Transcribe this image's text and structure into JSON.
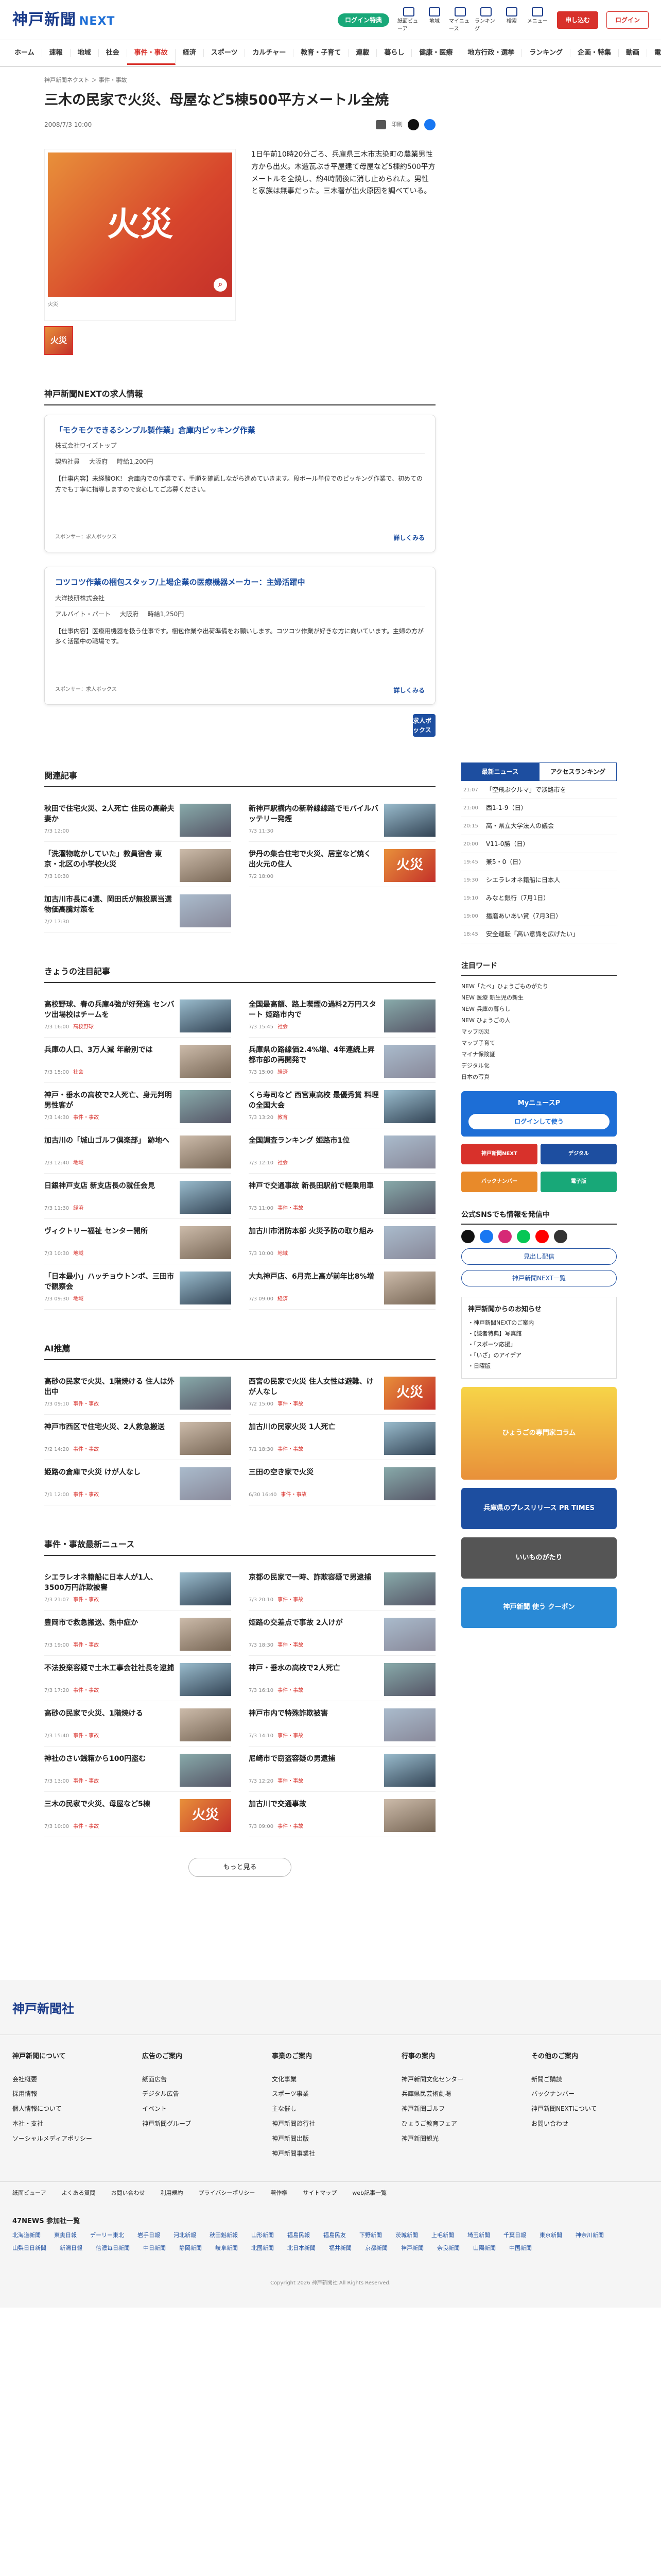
{
  "header": {
    "logo": "神戸新聞",
    "logo_sub": "NEXT",
    "cta": "ログイン特典",
    "icons": [
      "紙面ビューア",
      "地域",
      "マイニュース",
      "ランキング",
      "検索",
      "メニュー"
    ],
    "subscribe": "申し込む",
    "login": "ログイン"
  },
  "nav": [
    "ホーム",
    "速報",
    "地域",
    "社会",
    "事件・事故",
    "経済",
    "スポーツ",
    "カルチャー",
    "教育・子育て",
    "連載",
    "暮らし",
    "健康・医療",
    "地方行政・選挙",
    "ランキング",
    "企画・特集",
    "動画",
    "電子版"
  ],
  "nav_active_index": 4,
  "breadcrumb": "神戸新聞ネクスト ＞ 事件・事故",
  "article": {
    "title": "三木の民家で火災、母屋など5棟500平方メートル全焼",
    "date": "2008/7/3 10:00",
    "share_label": "印刷",
    "photo_text": "火災",
    "photo_caption": "火災",
    "thumb_text": "火災",
    "body": "1日午前10時20分ごろ、兵庫県三木市志染町の農業男性方から出火。木造瓦ぶき平屋建て母屋など5棟約500平方メートルを全焼し、約4時間後に消し止められた。男性と家族は無事だった。三木署が出火原因を調べている。"
  },
  "jobs": {
    "heading": "神戸新聞NEXTの求人情報",
    "items": [
      {
        "title": "「モクモクできるシンプル製作業」倉庫内ピッキング作業",
        "company": "株式会社ワイズトップ",
        "type": "契約社員",
        "place": "大阪府",
        "pay": "時給1,200円",
        "desc": "【仕事内容】未経験OK！ 倉庫内での作業です。手順を確認しながら進めていきます。段ボール単位でのピッキング作業で、初めての方でも丁寧に指導しますので安心してご応募ください。",
        "source": "スポンサー：求人ボックス",
        "more": "詳しくみる"
      },
      {
        "title": "コツコツ作業の梱包スタッフ/上場企業の医療機器メーカー：主婦活躍中",
        "company": "大洋技研株式会社",
        "type": "アルバイト・パート",
        "place": "大阪府",
        "pay": "時給1,250円",
        "desc": "【仕事内容】医療用機器を扱う仕事です。梱包作業や出荷準備をお願いします。コツコツ作業が好きな方に向いています。主婦の方が多く活躍中の職場です。",
        "source": "スポンサー：求人ボックス",
        "more": "詳しくみる"
      }
    ],
    "badge": "求人ボックス"
  },
  "related": {
    "heading": "関連記事",
    "items": [
      {
        "title": "秋田で住宅火災、2人死亡 住民の高齢夫妻か",
        "meta": "7/3 12:00",
        "tag": "",
        "th": "t1"
      },
      {
        "title": "新神戸駅構内の新幹線線路でモバイルバッテリー発煙",
        "meta": "7/3 11:30",
        "tag": "",
        "th": "t2"
      },
      {
        "title": "「洗濯物乾かしていた」教員宿舎 東京・北区の小学校火災",
        "meta": "7/3 10:30",
        "tag": "",
        "th": "t3"
      },
      {
        "title": "伊丹の集合住宅で火災、居室など焼く 出火元の住人",
        "meta": "7/2 18:00",
        "tag": "",
        "th": "tf"
      },
      {
        "title": "加古川市長に4選、岡田氏が無投票当選 物価高騰対策を",
        "meta": "7/2 17:30",
        "tag": "",
        "th": "t4"
      }
    ]
  },
  "featured": {
    "heading": "きょうの注目記事",
    "items": [
      {
        "title": "高校野球、春の兵庫4強が好発進 センバツ出場校はチームを",
        "meta": "7/3 16:00",
        "tag": "高校野球",
        "th": "t2"
      },
      {
        "title": "全国最高額、路上喫煙の過料2万円スタート 姫路市内で",
        "meta": "7/3 15:45",
        "tag": "社会",
        "th": "t1"
      },
      {
        "title": "兵庫の人口、3万人減 年齢別では",
        "meta": "7/3 15:00",
        "tag": "社会",
        "th": "t3"
      },
      {
        "title": "兵庫県の路線価2.4%増、4年連続上昇 都市部の再開発で",
        "meta": "7/3 15:00",
        "tag": "経済",
        "th": "t4"
      },
      {
        "title": "神戸・垂水の高校で2人死亡、身元判明 男性客が",
        "meta": "7/3 14:30",
        "tag": "事件・事故",
        "th": "t1"
      },
      {
        "title": "くら寿司など 西宮東高校 最優秀賞 料理の全国大会",
        "meta": "7/3 13:20",
        "tag": "教育",
        "th": "t2"
      },
      {
        "title": "加古川の「城山ゴルフ倶楽部」 跡地へ",
        "meta": "7/3 12:40",
        "tag": "地域",
        "th": "t3"
      },
      {
        "title": "全国調査ランキング 姫路市1位",
        "meta": "7/3 12:10",
        "tag": "社会",
        "th": "t4"
      },
      {
        "title": "日銀神戸支店 新支店長の就任会見",
        "meta": "7/3 11:30",
        "tag": "経済",
        "th": "t2"
      },
      {
        "title": "神戸で交通事故 新長田駅前で軽乗用車",
        "meta": "7/3 11:00",
        "tag": "事件・事故",
        "th": "t1"
      },
      {
        "title": "ヴィクトリー福祉 センター開所",
        "meta": "7/3 10:30",
        "tag": "地域",
        "th": "t3"
      },
      {
        "title": "加古川市消防本部 火災予防の取り組み",
        "meta": "7/3 10:00",
        "tag": "地域",
        "th": "t4"
      },
      {
        "title": "「日本最小」ハッチョウトンボ、三田市で観察会",
        "meta": "7/3 09:30",
        "tag": "地域",
        "th": "t2"
      },
      {
        "title": "大丸神戸店、6月売上高が前年比8%増",
        "meta": "7/3 09:00",
        "tag": "経済",
        "th": "t3"
      }
    ]
  },
  "ai": {
    "heading": "AI推薦",
    "items": [
      {
        "title": "高砂の民家で火災、1階焼ける 住人は外出中",
        "meta": "7/3 09:10",
        "tag": "事件・事故",
        "th": "t1"
      },
      {
        "title": "西宮の民家で火災 住人女性は避難、けが人なし",
        "meta": "7/2 15:00",
        "tag": "事件・事故",
        "th": "tf"
      },
      {
        "title": "神戸市西区で住宅火災、2人救急搬送",
        "meta": "7/2 14:20",
        "tag": "事件・事故",
        "th": "t3"
      },
      {
        "title": "加古川の民家火災 1人死亡",
        "meta": "7/1 18:30",
        "tag": "事件・事故",
        "th": "t2"
      },
      {
        "title": "姫路の倉庫で火災 けが人なし",
        "meta": "7/1 12:00",
        "tag": "事件・事故",
        "th": "t4"
      },
      {
        "title": "三田の空き家で火災",
        "meta": "6/30 16:40",
        "tag": "事件・事故",
        "th": "t1"
      }
    ]
  },
  "incident": {
    "heading": "事件・事故最新ニュース",
    "items": [
      {
        "title": "シエラレオネ籍船に日本人が1人、3500万円詐欺被害",
        "meta": "7/3 21:07",
        "tag": "事件・事故",
        "th": "t2"
      },
      {
        "title": "京都の民家で一時、詐欺容疑で男逮捕",
        "meta": "7/3 20:10",
        "tag": "事件・事故",
        "th": "t1"
      },
      {
        "title": "豊岡市で救急搬送、熱中症か",
        "meta": "7/3 19:00",
        "tag": "事件・事故",
        "th": "t3"
      },
      {
        "title": "姫路の交差点で事故 2人けが",
        "meta": "7/3 18:30",
        "tag": "事件・事故",
        "th": "t4"
      },
      {
        "title": "不法投棄容疑で土木工事会社社長を逮捕",
        "meta": "7/3 17:20",
        "tag": "事件・事故",
        "th": "t2"
      },
      {
        "title": "神戸・垂水の高校で2人死亡",
        "meta": "7/3 16:10",
        "tag": "事件・事故",
        "th": "t1"
      },
      {
        "title": "高砂の民家で火災、1階焼ける",
        "meta": "7/3 15:40",
        "tag": "事件・事故",
        "th": "t3"
      },
      {
        "title": "神戸市内で特殊詐欺被害",
        "meta": "7/3 14:10",
        "tag": "事件・事故",
        "th": "t4"
      },
      {
        "title": "神社のさい銭箱から100円盗む",
        "meta": "7/3 13:00",
        "tag": "事件・事故",
        "th": "t1"
      },
      {
        "title": "尼崎市で窃盗容疑の男逮捕",
        "meta": "7/3 12:20",
        "tag": "事件・事故",
        "th": "t2"
      },
      {
        "title": "三木の民家で火災、母屋など5棟",
        "meta": "7/3 10:00",
        "tag": "事件・事故",
        "th": "tf"
      },
      {
        "title": "加古川で交通事故",
        "meta": "7/3 09:00",
        "tag": "事件・事故",
        "th": "t3"
      }
    ],
    "more": "もっと見る"
  },
  "sidebar": {
    "rank_tabs": [
      "最新ニュース",
      "アクセスランキング"
    ],
    "ranking": [
      {
        "time": "21:07",
        "text": "「空飛ぶクルマ」で淡路市を"
      },
      {
        "time": "21:00",
        "text": "西1-1-9（日）"
      },
      {
        "time": "20:15",
        "text": "高・県立大学法人の議会"
      },
      {
        "time": "20:00",
        "text": "V11-0勝（日）"
      },
      {
        "time": "19:45",
        "text": "兼5・0（日）"
      },
      {
        "time": "19:30",
        "text": "シエラレオネ籍船に日本人"
      },
      {
        "time": "19:10",
        "text": "みなと銀行（7月1日）"
      },
      {
        "time": "19:00",
        "text": "播磨あいあい賞（7月3日）"
      },
      {
        "time": "18:45",
        "text": "安全運転「高い意識を広げたい」"
      }
    ],
    "watch_heading": "注目ワード",
    "watch": [
      "NEW「たべ」ひょうごものがたり",
      "NEW 医療 新生児の新生",
      "NEW 兵庫の暮らし",
      "NEW ひょうごの人",
      "マップ防災",
      "マップ子育て",
      "マイナ保険証",
      "デジタル化",
      "日本の写真"
    ],
    "mynews_title": "MyニュースP",
    "mynews_btn": "ログインして使う",
    "banners": [
      "神戸新聞NEXT",
      "デジタル",
      "バックナンバー",
      "電子版"
    ],
    "sns_heading": "公式SNSでも情報を発信中",
    "sns_btn1": "見出し配信",
    "sns_btn2": "神戸新聞NEXT一覧",
    "notice_title": "神戸新聞からのお知らせ",
    "notices": [
      "・神戸新聞NEXTのご案内",
      "・【読者特典】写真館",
      "・「スポーツ応援」",
      "・「いざ」のアイデア",
      "・日曜版"
    ],
    "ad1": "ひょうごの専門家コラム",
    "ad2": "兵庫県のプレスリリース PR TIMES",
    "ad3": "いいものがたり",
    "ad4": "神戸新聞 使う クーポン"
  },
  "footer": {
    "logo": "神戸新聞社",
    "cols": [
      {
        "h": "神戸新聞について",
        "items": [
          "会社概要",
          "採用情報",
          "個人情報について",
          "本社・支社",
          "ソーシャルメディアポリシー"
        ]
      },
      {
        "h": "広告のご案内",
        "items": [
          "紙面広告",
          "デジタル広告",
          "イベント",
          "神戸新聞グループ"
        ]
      },
      {
        "h": "事業のご案内",
        "items": [
          "文化事業",
          "スポーツ事業",
          "主な催し",
          "神戸新聞旅行社",
          "神戸新聞出版",
          "神戸新聞事業社"
        ]
      },
      {
        "h": "行事の案内",
        "items": [
          "神戸新聞文化センター",
          "兵庫県民芸術劇場",
          "神戸新聞ゴルフ",
          "ひょうご教育フェア",
          "神戸新聞観光"
        ]
      },
      {
        "h": "その他のご案内",
        "items": [
          "新聞ご購読",
          "バックナンバー",
          "神戸新聞NEXTについて",
          "お問い合わせ"
        ]
      }
    ],
    "bar": [
      "紙面ビューア",
      "よくある質問",
      "お問い合わせ",
      "利用規約",
      "プライバシーポリシー",
      "著作権",
      "サイトマップ",
      "web記事一覧"
    ],
    "n47_heading": "47NEWS 参加社一覧",
    "n47": [
      "北海道新聞",
      "東奥日報",
      "デーリー東北",
      "岩手日報",
      "河北新報",
      "秋田魁新報",
      "山形新聞",
      "福島民報",
      "福島民友",
      "下野新聞",
      "茨城新聞",
      "上毛新聞",
      "埼玉新聞",
      "千葉日報",
      "東京新聞",
      "神奈川新聞",
      "山梨日日新聞",
      "新潟日報",
      "信濃毎日新聞",
      "中日新聞",
      "静岡新聞",
      "岐阜新聞",
      "北國新聞",
      "北日本新聞",
      "福井新聞",
      "京都新聞",
      "神戸新聞",
      "奈良新聞",
      "山陽新聞",
      "中国新聞"
    ],
    "copy": "Copyright 2026 神戸新聞社 All Rights Reserved."
  }
}
